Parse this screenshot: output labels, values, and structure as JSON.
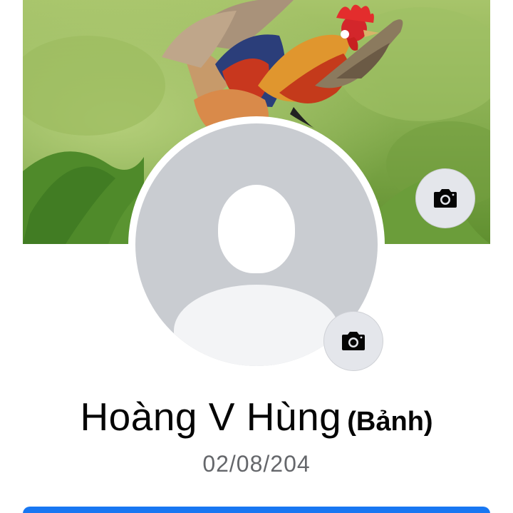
{
  "profile": {
    "name": "Hoàng V Hùng",
    "alternate_name": "(Bảnh)",
    "subtext": "02/08/204"
  },
  "icons": {
    "cover_camera": "camera-icon",
    "avatar_camera": "camera-icon",
    "avatar_placeholder": "default-avatar-icon"
  },
  "colors": {
    "primary_button": "#1877f2",
    "camera_button_bg": "#e4e6eb",
    "avatar_bg": "#c9ccd1",
    "name_text": "#050505",
    "subtext": "#65676b"
  }
}
